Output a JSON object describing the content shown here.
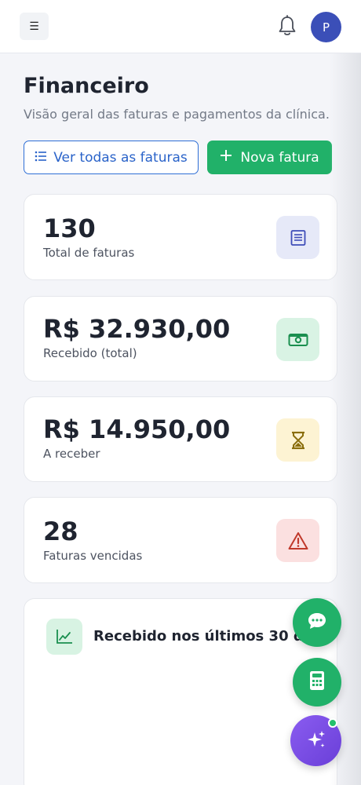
{
  "header": {
    "menu_icon": "menu-icon",
    "menu_glyph": "☰",
    "notification_icon": "bell-icon",
    "avatar_initial": "P"
  },
  "page": {
    "title": "Financeiro",
    "subtitle": "Visão geral das faturas e pagamentos da clínica."
  },
  "actions": {
    "view_all_label": "Ver todas as faturas",
    "view_all_icon": "list-icon",
    "new_invoice_label": "Nova fatura",
    "new_invoice_icon": "plus-icon",
    "new_invoice_glyph": "+"
  },
  "stats": [
    {
      "value": "130",
      "label": "Total de faturas",
      "icon": "invoice-icon",
      "icon_bg": "#e6e9f8",
      "icon_color": "#3e4cb8"
    },
    {
      "value": "R$ 32.930,00",
      "label": "Recebido (total)",
      "icon": "money-icon",
      "icon_bg": "#d9f3e4",
      "icon_color": "#1a8f4f"
    },
    {
      "value": "R$ 14.950,00",
      "label": "A receber",
      "icon": "hourglass-icon",
      "icon_bg": "#fdf3d3",
      "icon_color": "#a07f10"
    },
    {
      "value": "28",
      "label": "Faturas vencidas",
      "icon": "warning-icon",
      "icon_bg": "#fbe0e0",
      "icon_color": "#c0392b"
    }
  ],
  "chart_section": {
    "title": "Recebido nos últimos 30 dias",
    "icon": "line-chart-icon"
  },
  "floating_buttons": [
    {
      "name": "chat-fab",
      "icon": "chat-icon",
      "color": "#21b169"
    },
    {
      "name": "calculator-fab",
      "icon": "calculator-icon",
      "color": "#21b169"
    },
    {
      "name": "assistant-fab",
      "icon": "sparkles-icon",
      "color": "#7b4fe0"
    }
  ],
  "colors": {
    "primary_blue": "#2a63c9",
    "primary_green": "#21b169",
    "assistant_purple": "#7b4fe0",
    "online_dot": "#23c16b"
  }
}
